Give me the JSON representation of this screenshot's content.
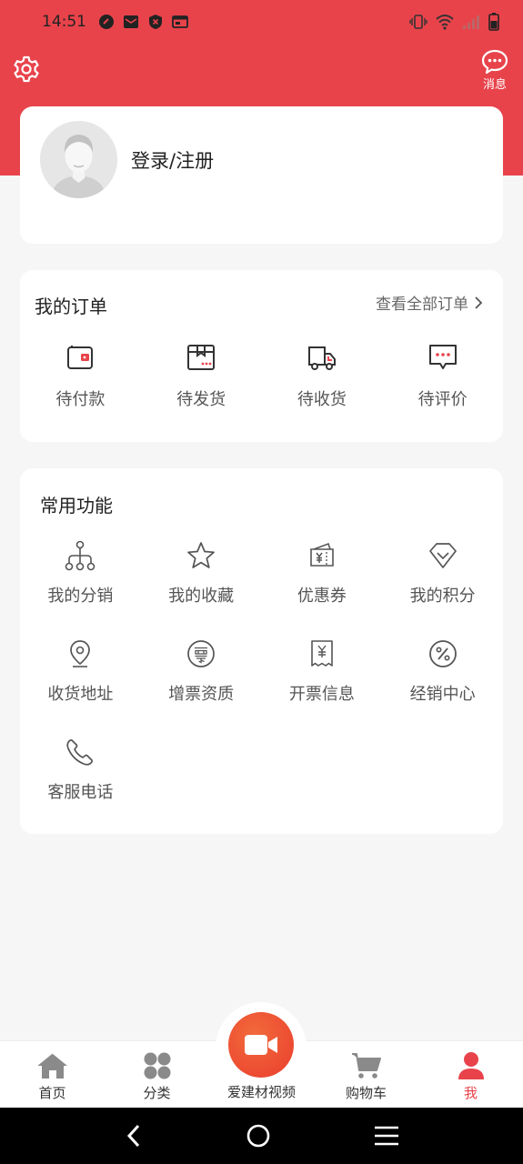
{
  "status": {
    "time": "14:51"
  },
  "header": {
    "messages_label": "消息"
  },
  "profile": {
    "login_label": "登录/注册"
  },
  "orders": {
    "title": "我的订单",
    "view_all": "查看全部订单",
    "items": [
      {
        "label": "待付款",
        "icon": "wallet-icon"
      },
      {
        "label": "待发货",
        "icon": "package-icon"
      },
      {
        "label": "待收货",
        "icon": "truck-icon"
      },
      {
        "label": "待评价",
        "icon": "comment-icon"
      }
    ]
  },
  "functions": {
    "title": "常用功能",
    "items": [
      {
        "label": "我的分销",
        "icon": "distribution-icon"
      },
      {
        "label": "我的收藏",
        "icon": "star-icon"
      },
      {
        "label": "优惠券",
        "icon": "coupon-icon"
      },
      {
        "label": "我的积分",
        "icon": "diamond-icon"
      },
      {
        "label": "收货地址",
        "icon": "location-icon"
      },
      {
        "label": "增票资质",
        "icon": "invoice-badge-icon"
      },
      {
        "label": "开票信息",
        "icon": "receipt-icon"
      },
      {
        "label": "经销中心",
        "icon": "percent-icon"
      },
      {
        "label": "客服电话",
        "icon": "phone-icon"
      }
    ]
  },
  "bottom_nav": {
    "items": [
      {
        "label": "首页",
        "icon": "home-icon"
      },
      {
        "label": "分类",
        "icon": "category-icon"
      },
      {
        "label": "爱建材视频",
        "icon": "video-camera-icon"
      },
      {
        "label": "购物车",
        "icon": "cart-icon"
      },
      {
        "label": "我",
        "icon": "user-icon",
        "active": true
      }
    ]
  },
  "colors": {
    "brand": "#e8434b",
    "accent_orange": "#f26a3b"
  }
}
